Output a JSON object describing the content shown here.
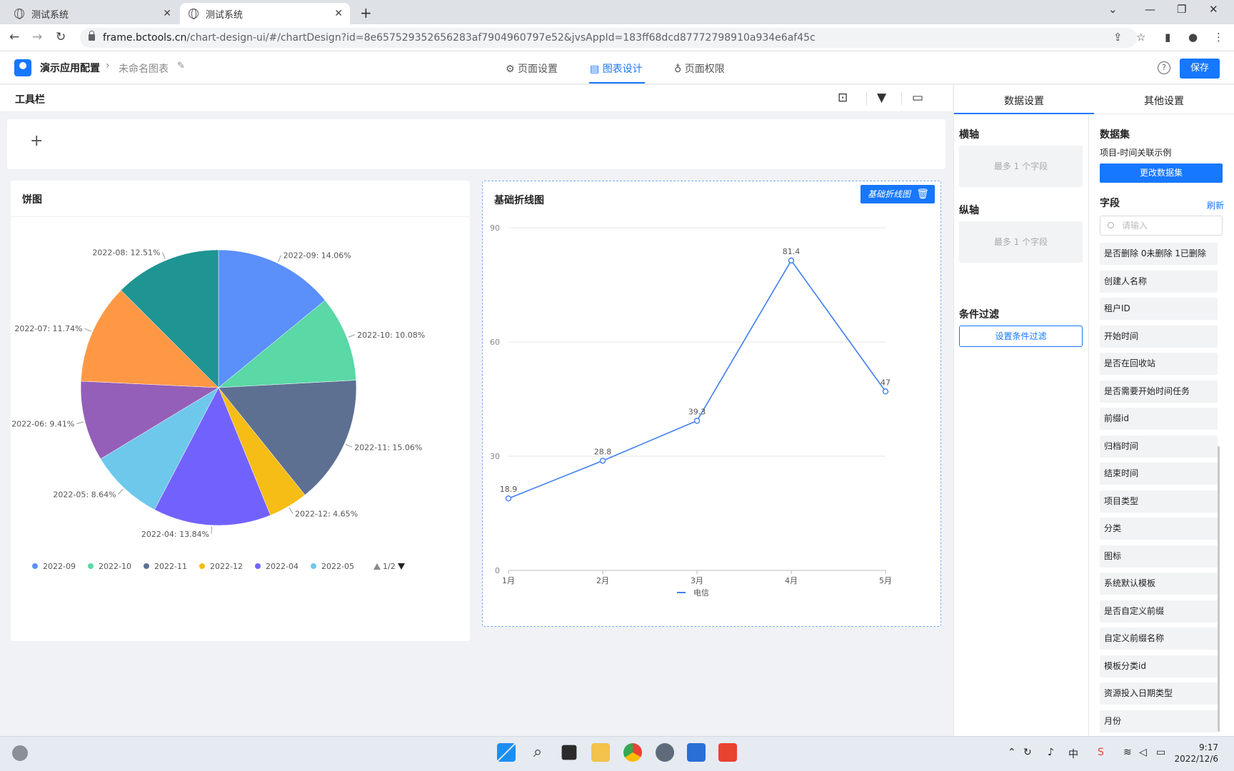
{
  "browser": {
    "tabs": [
      {
        "title": "测试系统",
        "active": false
      },
      {
        "title": "测试系统",
        "active": true
      }
    ],
    "url_host": "frame.bctools.cn",
    "url_path": "/chart-design-ui/#/chartDesign?id=8e657529352656283af7904960797e52&jvsAppId=183ff68dcd87772798910a934e6af45c"
  },
  "header": {
    "app_name": "演示应用配置",
    "chart_name": "未命名图表",
    "tabs": [
      {
        "label": "页面设置",
        "icon": "gear-icon"
      },
      {
        "label": "图表设计",
        "icon": "chart-icon",
        "active": true
      },
      {
        "label": "页面权限",
        "icon": "lock-icon"
      }
    ],
    "help_symbol": "?",
    "save_label": "保存"
  },
  "toolbar": {
    "title": "工具栏",
    "add_symbol": "+"
  },
  "pie_card": {
    "title": "饼图",
    "legend_pager": "1/2"
  },
  "line_card": {
    "title": "基础折线图",
    "tag_label": "基础折线图"
  },
  "chart_data": [
    {
      "type": "pie",
      "title": "饼图",
      "slices": [
        {
          "label": "2022-09",
          "value": 14.06,
          "color": "#5b8ff9"
        },
        {
          "label": "2022-10",
          "value": 10.08,
          "color": "#5ad8a6"
        },
        {
          "label": "2022-11",
          "value": 15.06,
          "color": "#5d7092"
        },
        {
          "label": "2022-12",
          "value": 4.65,
          "color": "#f6bd16"
        },
        {
          "label": "2022-04",
          "value": 13.84,
          "color": "#7262fd"
        },
        {
          "label": "2022-05",
          "value": 8.64,
          "color": "#6dc8ec"
        },
        {
          "label": "2022-06",
          "value": 9.41,
          "color": "#945fb9"
        },
        {
          "label": "2022-07",
          "value": 11.74,
          "color": "#ff9845"
        },
        {
          "label": "2022-08",
          "value": 12.51,
          "color": "#1e9493"
        }
      ],
      "legend_visible": [
        "2022-09",
        "2022-10",
        "2022-11",
        "2022-12",
        "2022-04",
        "2022-05"
      ],
      "legend_position": "bottom"
    },
    {
      "type": "line",
      "title": "基础折线图",
      "categories": [
        "1月",
        "2月",
        "3月",
        "4月",
        "5月"
      ],
      "series": [
        {
          "name": "电信",
          "values": [
            18.9,
            28.8,
            39.3,
            81.4,
            47
          ],
          "color": "#3f7ef0"
        }
      ],
      "ylim": [
        0,
        90
      ],
      "yticks": [
        0,
        30,
        60,
        90
      ],
      "grid": true,
      "legend_position": "bottom"
    }
  ],
  "right_panel": {
    "tabs": [
      "数据设置",
      "其他设置"
    ],
    "x_axis": {
      "title": "横轴",
      "placeholder": "最多 1 个字段"
    },
    "y_axis": {
      "title": "纵轴",
      "placeholder": "最多 1 个字段"
    },
    "filter": {
      "title": "条件过滤",
      "button": "设置条件过滤"
    },
    "dataset": {
      "title": "数据集",
      "name": "项目-时间关联示例",
      "change_button": "更改数据集"
    },
    "fields_section": {
      "title": "字段",
      "refresh": "刷新",
      "search_placeholder": "请输入"
    },
    "fields": [
      "是否删除 0未删除 1已删除",
      "创建人名称",
      "租户ID",
      "开始时间",
      "是否在回收站",
      "是否需要开始时间任务",
      "前缀id",
      "归档时间",
      "结束时间",
      "项目类型",
      "分类",
      "图标",
      "系统默认模板",
      "是否自定义前缀",
      "自定义前缀名称",
      "模板分类id",
      "资源投入日期类型",
      "月份"
    ]
  },
  "taskbar": {
    "time": "9:17",
    "date": "2022/12/6",
    "ime": "中"
  }
}
